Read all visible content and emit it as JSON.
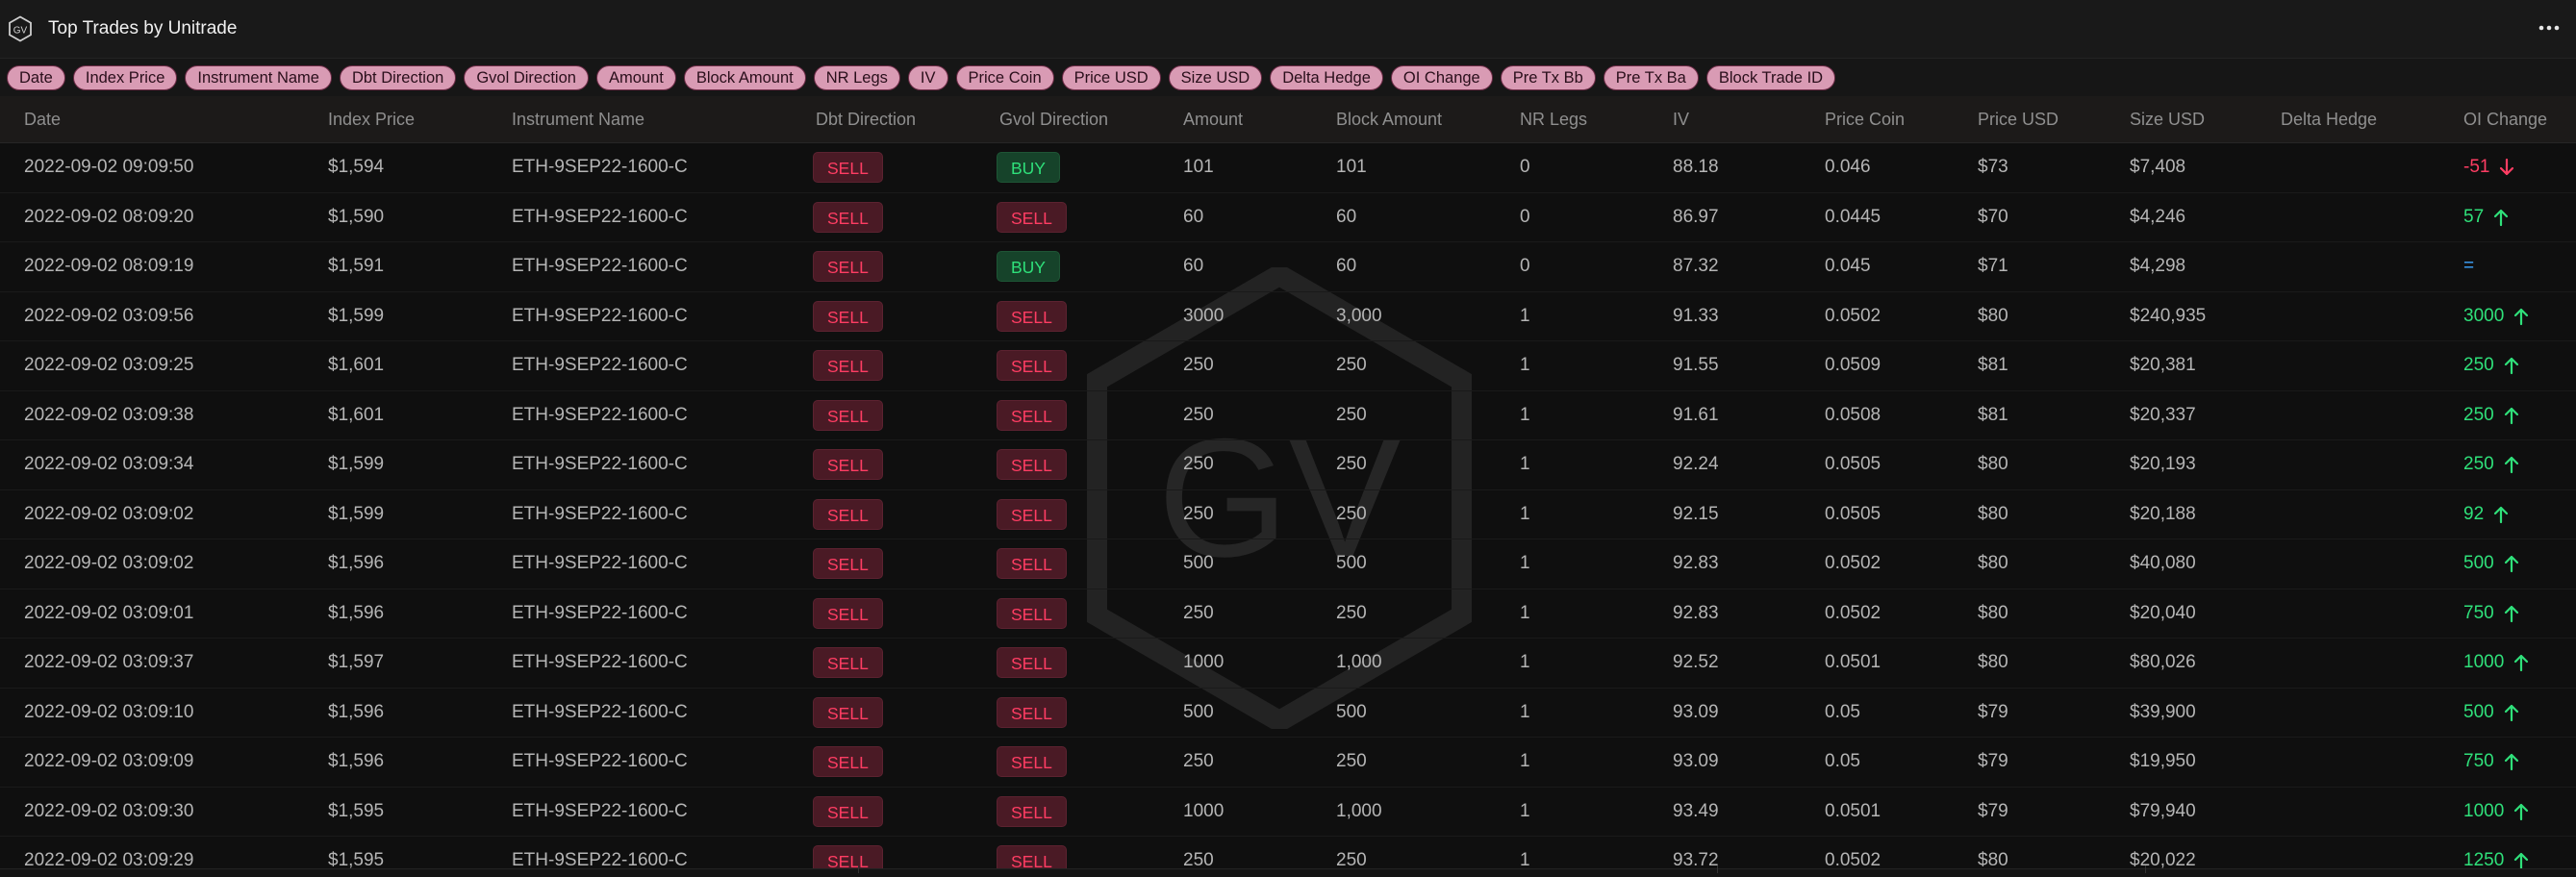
{
  "app": {
    "title": "Top Trades by Unitrade",
    "logo_text": "GV",
    "watermark_text": "GV"
  },
  "chips": [
    "Date",
    "Index Price",
    "Instrument Name",
    "Dbt Direction",
    "Gvol Direction",
    "Amount",
    "Block Amount",
    "NR Legs",
    "IV",
    "Price Coin",
    "Price USD",
    "Size USD",
    "Delta Hedge",
    "OI Change",
    "Pre Tx Bb",
    "Pre Tx Ba",
    "Block Trade ID"
  ],
  "columns": [
    "Date",
    "Index Price",
    "Instrument Name",
    "Dbt Direction",
    "Gvol Direction",
    "Amount",
    "Block Amount",
    "NR Legs",
    "IV",
    "Price Coin",
    "Price USD",
    "Size USD",
    "Delta Hedge",
    "OI Change"
  ],
  "colors": {
    "sell": "#ff3d63",
    "buy": "#2fe07a",
    "equal": "#3ea6ff",
    "chip_bg": "#d99bb4"
  },
  "rows": [
    {
      "date": "2022-09-02 09:09:50",
      "index_price": "$1,594",
      "instrument": "ETH-9SEP22-1600-C",
      "dbt": "SELL",
      "gvol": "BUY",
      "amount": "101",
      "block_amount": "101",
      "nr_legs": "0",
      "iv": "88.18",
      "price_coin": "0.046",
      "price_usd": "$73",
      "size_usd": "$7,408",
      "delta_hedge": "",
      "oi_change": "-51",
      "oi_dir": "down"
    },
    {
      "date": "2022-09-02 08:09:20",
      "index_price": "$1,590",
      "instrument": "ETH-9SEP22-1600-C",
      "dbt": "SELL",
      "gvol": "SELL",
      "amount": "60",
      "block_amount": "60",
      "nr_legs": "0",
      "iv": "86.97",
      "price_coin": "0.0445",
      "price_usd": "$70",
      "size_usd": "$4,246",
      "delta_hedge": "",
      "oi_change": "57",
      "oi_dir": "up"
    },
    {
      "date": "2022-09-02 08:09:19",
      "index_price": "$1,591",
      "instrument": "ETH-9SEP22-1600-C",
      "dbt": "SELL",
      "gvol": "BUY",
      "amount": "60",
      "block_amount": "60",
      "nr_legs": "0",
      "iv": "87.32",
      "price_coin": "0.045",
      "price_usd": "$71",
      "size_usd": "$4,298",
      "delta_hedge": "",
      "oi_change": "=",
      "oi_dir": "eq"
    },
    {
      "date": "2022-09-02 03:09:56",
      "index_price": "$1,599",
      "instrument": "ETH-9SEP22-1600-C",
      "dbt": "SELL",
      "gvol": "SELL",
      "amount": "3000",
      "block_amount": "3,000",
      "nr_legs": "1",
      "iv": "91.33",
      "price_coin": "0.0502",
      "price_usd": "$80",
      "size_usd": "$240,935",
      "delta_hedge": "",
      "oi_change": "3000",
      "oi_dir": "up"
    },
    {
      "date": "2022-09-02 03:09:25",
      "index_price": "$1,601",
      "instrument": "ETH-9SEP22-1600-C",
      "dbt": "SELL",
      "gvol": "SELL",
      "amount": "250",
      "block_amount": "250",
      "nr_legs": "1",
      "iv": "91.55",
      "price_coin": "0.0509",
      "price_usd": "$81",
      "size_usd": "$20,381",
      "delta_hedge": "",
      "oi_change": "250",
      "oi_dir": "up"
    },
    {
      "date": "2022-09-02 03:09:38",
      "index_price": "$1,601",
      "instrument": "ETH-9SEP22-1600-C",
      "dbt": "SELL",
      "gvol": "SELL",
      "amount": "250",
      "block_amount": "250",
      "nr_legs": "1",
      "iv": "91.61",
      "price_coin": "0.0508",
      "price_usd": "$81",
      "size_usd": "$20,337",
      "delta_hedge": "",
      "oi_change": "250",
      "oi_dir": "up"
    },
    {
      "date": "2022-09-02 03:09:34",
      "index_price": "$1,599",
      "instrument": "ETH-9SEP22-1600-C",
      "dbt": "SELL",
      "gvol": "SELL",
      "amount": "250",
      "block_amount": "250",
      "nr_legs": "1",
      "iv": "92.24",
      "price_coin": "0.0505",
      "price_usd": "$80",
      "size_usd": "$20,193",
      "delta_hedge": "",
      "oi_change": "250",
      "oi_dir": "up"
    },
    {
      "date": "2022-09-02 03:09:02",
      "index_price": "$1,599",
      "instrument": "ETH-9SEP22-1600-C",
      "dbt": "SELL",
      "gvol": "SELL",
      "amount": "250",
      "block_amount": "250",
      "nr_legs": "1",
      "iv": "92.15",
      "price_coin": "0.0505",
      "price_usd": "$80",
      "size_usd": "$20,188",
      "delta_hedge": "",
      "oi_change": "92",
      "oi_dir": "up"
    },
    {
      "date": "2022-09-02 03:09:02",
      "index_price": "$1,596",
      "instrument": "ETH-9SEP22-1600-C",
      "dbt": "SELL",
      "gvol": "SELL",
      "amount": "500",
      "block_amount": "500",
      "nr_legs": "1",
      "iv": "92.83",
      "price_coin": "0.0502",
      "price_usd": "$80",
      "size_usd": "$40,080",
      "delta_hedge": "",
      "oi_change": "500",
      "oi_dir": "up"
    },
    {
      "date": "2022-09-02 03:09:01",
      "index_price": "$1,596",
      "instrument": "ETH-9SEP22-1600-C",
      "dbt": "SELL",
      "gvol": "SELL",
      "amount": "250",
      "block_amount": "250",
      "nr_legs": "1",
      "iv": "92.83",
      "price_coin": "0.0502",
      "price_usd": "$80",
      "size_usd": "$20,040",
      "delta_hedge": "",
      "oi_change": "750",
      "oi_dir": "up"
    },
    {
      "date": "2022-09-02 03:09:37",
      "index_price": "$1,597",
      "instrument": "ETH-9SEP22-1600-C",
      "dbt": "SELL",
      "gvol": "SELL",
      "amount": "1000",
      "block_amount": "1,000",
      "nr_legs": "1",
      "iv": "92.52",
      "price_coin": "0.0501",
      "price_usd": "$80",
      "size_usd": "$80,026",
      "delta_hedge": "",
      "oi_change": "1000",
      "oi_dir": "up"
    },
    {
      "date": "2022-09-02 03:09:10",
      "index_price": "$1,596",
      "instrument": "ETH-9SEP22-1600-C",
      "dbt": "SELL",
      "gvol": "SELL",
      "amount": "500",
      "block_amount": "500",
      "nr_legs": "1",
      "iv": "93.09",
      "price_coin": "0.05",
      "price_usd": "$79",
      "size_usd": "$39,900",
      "delta_hedge": "",
      "oi_change": "500",
      "oi_dir": "up"
    },
    {
      "date": "2022-09-02 03:09:09",
      "index_price": "$1,596",
      "instrument": "ETH-9SEP22-1600-C",
      "dbt": "SELL",
      "gvol": "SELL",
      "amount": "250",
      "block_amount": "250",
      "nr_legs": "1",
      "iv": "93.09",
      "price_coin": "0.05",
      "price_usd": "$79",
      "size_usd": "$19,950",
      "delta_hedge": "",
      "oi_change": "750",
      "oi_dir": "up"
    },
    {
      "date": "2022-09-02 03:09:30",
      "index_price": "$1,595",
      "instrument": "ETH-9SEP22-1600-C",
      "dbt": "SELL",
      "gvol": "SELL",
      "amount": "1000",
      "block_amount": "1,000",
      "nr_legs": "1",
      "iv": "93.49",
      "price_coin": "0.0501",
      "price_usd": "$79",
      "size_usd": "$79,940",
      "delta_hedge": "",
      "oi_change": "1000",
      "oi_dir": "up"
    },
    {
      "date": "2022-09-02 03:09:29",
      "index_price": "$1,595",
      "instrument": "ETH-9SEP22-1600-C",
      "dbt": "SELL",
      "gvol": "SELL",
      "amount": "250",
      "block_amount": "250",
      "nr_legs": "1",
      "iv": "93.72",
      "price_coin": "0.0502",
      "price_usd": "$80",
      "size_usd": "$20,022",
      "delta_hedge": "",
      "oi_change": "1250",
      "oi_dir": "up"
    }
  ]
}
